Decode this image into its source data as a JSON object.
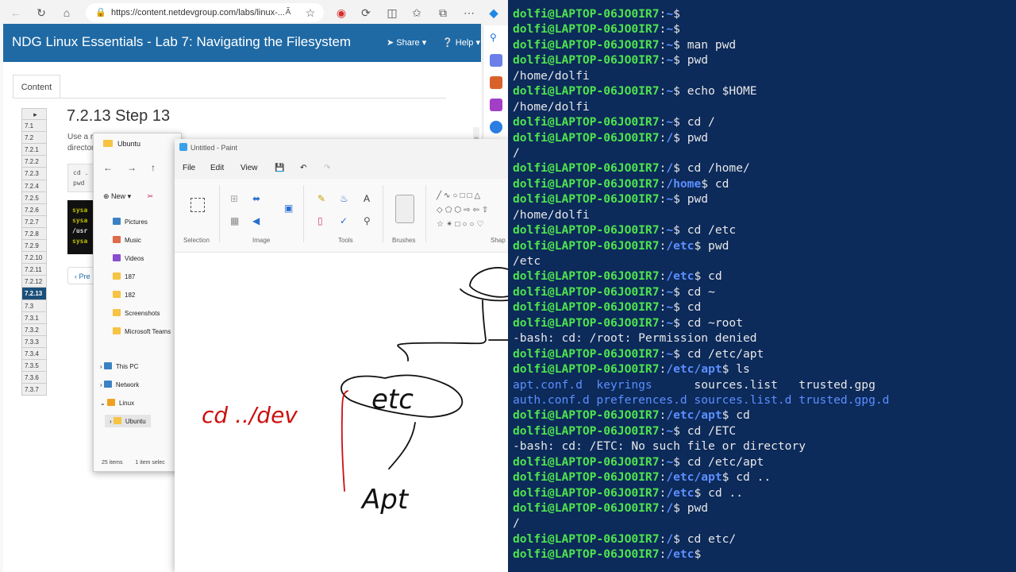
{
  "browser": {
    "url": "https://content.netdevgroup.com/labs/linux-...",
    "reader_icon": "Ã",
    "lab_title": "NDG Linux Essentials - Lab 7: Navigating the Filesystem",
    "share_label": "Share",
    "help_label": "Help",
    "content_tab": "Content",
    "toc_arrow": "▸",
    "toc": [
      "7.1",
      "7.2",
      "7.2.1",
      "7.2.2",
      "7.2.3",
      "7.2.4",
      "7.2.5",
      "7.2.6",
      "7.2.7",
      "7.2.8",
      "7.2.9",
      "7.2.10",
      "7.2.11",
      "7.2.12",
      "7.2.13",
      "7.3",
      "7.3.1",
      "7.3.2",
      "7.3.3",
      "7.3.4",
      "7.3.5",
      "7.3.6",
      "7.3.7"
    ],
    "toc_active": "7.2.13",
    "step_title": "7.2.13 Step 13",
    "step_text_line1": "Use a r",
    "step_text_line2": "director",
    "code_line1": "cd .",
    "code_line2": "pwd",
    "term_lines": [
      "sysa",
      "sysa",
      "/usr",
      "sysa"
    ],
    "prev_label": "‹ Pre"
  },
  "explorer": {
    "title": "Ubuntu",
    "new_label": "New",
    "sidebar": [
      {
        "label": "Pictures",
        "icon": "pictures-icon",
        "color": "#3b82c4"
      },
      {
        "label": "Music",
        "icon": "music-icon",
        "color": "#e06b4a"
      },
      {
        "label": "Videos",
        "icon": "videos-icon",
        "color": "#8a4fd0"
      },
      {
        "label": "187",
        "icon": "folder-icon",
        "color": "#f6c343"
      },
      {
        "label": "182",
        "icon": "folder-icon",
        "color": "#f6c343"
      },
      {
        "label": "Screenshots",
        "icon": "folder-icon",
        "color": "#f6c343"
      },
      {
        "label": "Microsoft Teams",
        "icon": "folder-icon",
        "color": "#f6c343"
      }
    ],
    "tree": [
      {
        "label": "This PC",
        "icon": "computer-icon"
      },
      {
        "label": "Network",
        "icon": "network-icon"
      },
      {
        "label": "Linux",
        "icon": "linux-icon"
      },
      {
        "label": "Ubuntu",
        "icon": "folder-icon"
      }
    ],
    "status_items": "25 items",
    "status_selected": "1 item selec"
  },
  "paint": {
    "title": "Untitled - Paint",
    "menu": [
      "File",
      "Edit",
      "View"
    ],
    "groups": [
      "Selection",
      "Image",
      "Tools",
      "Brushes",
      "Shap"
    ],
    "drawing_text_1": "cd ../dev",
    "drawing_text_2": "etc",
    "drawing_text_3": "Apt"
  },
  "terminal": {
    "user": "dolfi@LAPTOP-06JO0IR7",
    "lines": [
      {
        "type": "prompt",
        "path": "~",
        "cmd": ""
      },
      {
        "type": "prompt",
        "path": "~",
        "cmd": ""
      },
      {
        "type": "prompt",
        "path": "~",
        "cmd": "man pwd"
      },
      {
        "type": "prompt",
        "path": "~",
        "cmd": "pwd"
      },
      {
        "type": "out",
        "text": "/home/dolfi"
      },
      {
        "type": "prompt",
        "path": "~",
        "cmd": "echo $HOME"
      },
      {
        "type": "out",
        "text": "/home/dolfi"
      },
      {
        "type": "prompt",
        "path": "~",
        "cmd": "cd /"
      },
      {
        "type": "prompt",
        "path": "/",
        "cmd": "pwd"
      },
      {
        "type": "out",
        "text": "/"
      },
      {
        "type": "prompt",
        "path": "/",
        "cmd": "cd /home/"
      },
      {
        "type": "prompt",
        "path": "/home",
        "cmd": "cd"
      },
      {
        "type": "prompt",
        "path": "~",
        "cmd": "pwd"
      },
      {
        "type": "out",
        "text": "/home/dolfi"
      },
      {
        "type": "prompt",
        "path": "~",
        "cmd": "cd /etc"
      },
      {
        "type": "prompt",
        "path": "/etc",
        "cmd": "pwd"
      },
      {
        "type": "out",
        "text": "/etc"
      },
      {
        "type": "prompt",
        "path": "/etc",
        "cmd": "cd"
      },
      {
        "type": "prompt",
        "path": "~",
        "cmd": "cd ~"
      },
      {
        "type": "prompt",
        "path": "~",
        "cmd": "cd"
      },
      {
        "type": "prompt",
        "path": "~",
        "cmd": "cd ~root"
      },
      {
        "type": "out",
        "text": "-bash: cd: /root: Permission denied"
      },
      {
        "type": "prompt",
        "path": "~",
        "cmd": "cd /etc/apt"
      },
      {
        "type": "prompt",
        "path": "/etc/apt",
        "cmd": "ls"
      },
      {
        "type": "ls",
        "cols": [
          {
            "t": "apt.conf.d",
            "dir": true,
            "w": 12
          },
          {
            "t": "keyrings",
            "dir": true,
            "w": 14
          },
          {
            "t": "sources.list",
            "dir": false,
            "w": 15
          },
          {
            "t": "trusted.gpg",
            "dir": false,
            "w": 0
          }
        ]
      },
      {
        "type": "ls",
        "cols": [
          {
            "t": "auth.conf.d",
            "dir": true,
            "w": 12
          },
          {
            "t": "preferences.d",
            "dir": true,
            "w": 14
          },
          {
            "t": "sources.list.d",
            "dir": true,
            "w": 15
          },
          {
            "t": "trusted.gpg.d",
            "dir": true,
            "w": 0
          }
        ]
      },
      {
        "type": "prompt",
        "path": "/etc/apt",
        "cmd": "cd"
      },
      {
        "type": "prompt",
        "path": "~",
        "cmd": "cd /ETC"
      },
      {
        "type": "out",
        "text": "-bash: cd: /ETC: No such file or directory"
      },
      {
        "type": "prompt",
        "path": "~",
        "cmd": "cd /etc/apt"
      },
      {
        "type": "prompt",
        "path": "/etc/apt",
        "cmd": "cd .."
      },
      {
        "type": "prompt",
        "path": "/etc",
        "cmd": "cd .."
      },
      {
        "type": "prompt",
        "path": "/",
        "cmd": "pwd"
      },
      {
        "type": "out",
        "text": "/"
      },
      {
        "type": "prompt",
        "path": "/",
        "cmd": "cd etc/"
      },
      {
        "type": "prompt",
        "path": "/etc",
        "cmd": ""
      }
    ]
  }
}
